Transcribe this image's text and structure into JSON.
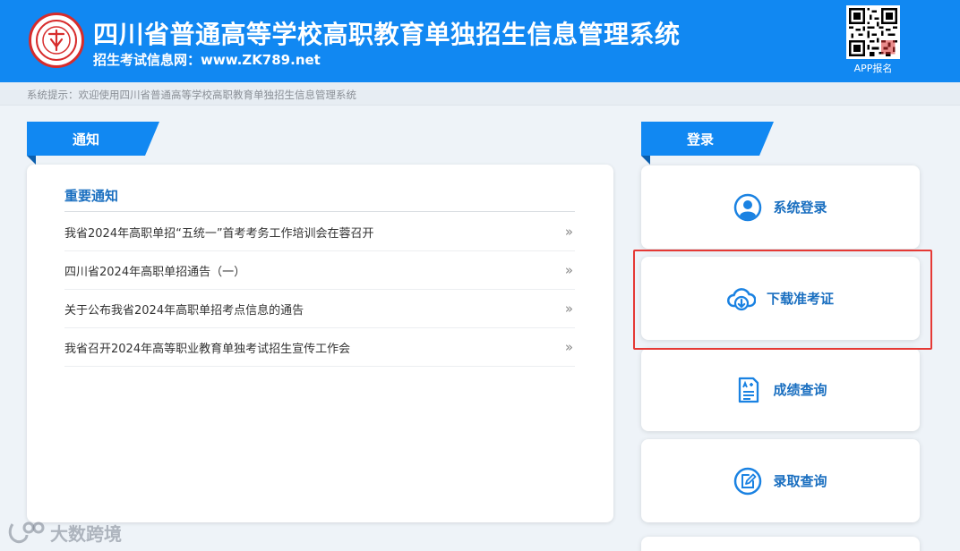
{
  "header": {
    "title": "四川省普通高等学校高职教育单独招生信息管理系统",
    "subtitle": "招生考试信息网：www.ZK789.net",
    "qr_label": "APP报名",
    "brand_color": "#1188f2"
  },
  "tip": {
    "text": "系统提示：欢迎使用四川省普通高等学校高职教育单独招生信息管理系统"
  },
  "notice": {
    "tab_label": "通知",
    "heading": "重要通知",
    "items": [
      {
        "text": "我省2024年高职单招“五统一”首考考务工作培训会在蓉召开"
      },
      {
        "text": "四川省2024年高职单招通告（一）"
      },
      {
        "text": "关于公布我省2024年高职单招考点信息的通告"
      },
      {
        "text": "我省召开2024年高等职业教育单独考试招生宣传工作会"
      }
    ],
    "item_chevron": "»"
  },
  "login": {
    "tab_label": "登录",
    "cards": [
      {
        "label": "系统登录",
        "icon": "user-icon"
      },
      {
        "label": "下载准考证",
        "icon": "cloud-download-icon"
      },
      {
        "label": "成绩查询",
        "icon": "score-document-icon"
      },
      {
        "label": "录取查询",
        "icon": "edit-icon"
      }
    ],
    "highlight_color": "#e53935"
  },
  "watermark": {
    "text": "大数跨境"
  }
}
